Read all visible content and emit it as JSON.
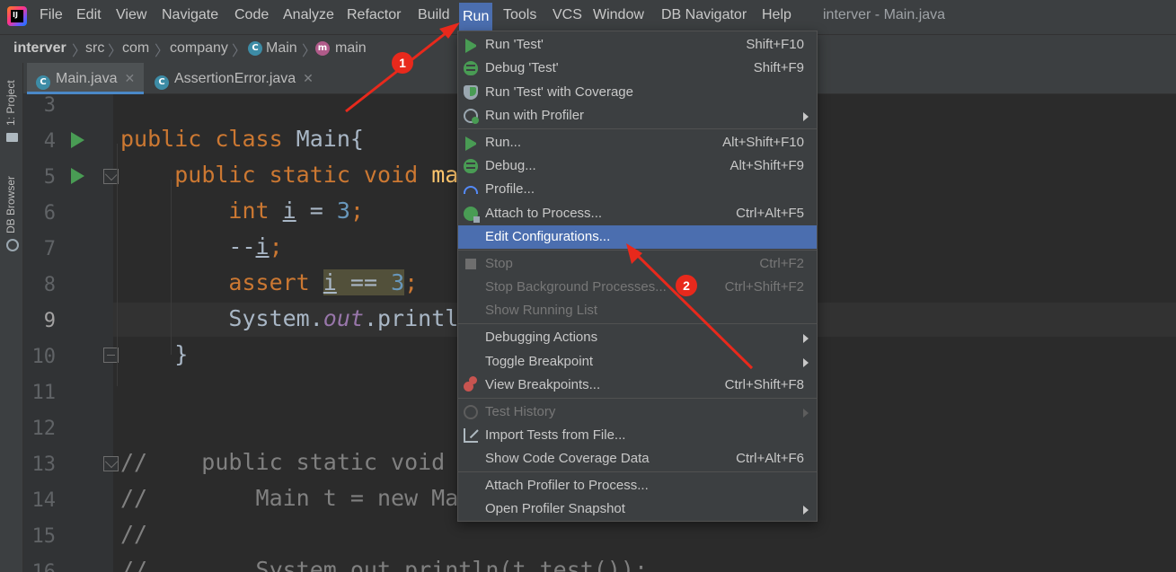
{
  "menubar": {
    "items": [
      "File",
      "Edit",
      "View",
      "Navigate",
      "Code",
      "Analyze",
      "Refactor",
      "Build",
      "Run",
      "Tools",
      "VCS",
      "Window",
      "DB Navigator",
      "Help"
    ],
    "window_title": "interver - Main.java"
  },
  "breadcrumbs": {
    "project": "interver",
    "dir1": "src",
    "dir2": "com",
    "dir3": "company",
    "class": "Main",
    "method": "main"
  },
  "tool_stripe": {
    "project": "1: Project",
    "db": "DB Browser"
  },
  "tabs": [
    {
      "label": "Main.java"
    },
    {
      "label": "AssertionError.java"
    }
  ],
  "editor": {
    "line_numbers": [
      "3",
      "4",
      "5",
      "6",
      "7",
      "8",
      "9",
      "10",
      "11",
      "12",
      "13",
      "14",
      "15",
      "16"
    ]
  },
  "run_menu": {
    "items": [
      {
        "label": "Run 'Test'",
        "shortcut": "Shift+F10",
        "icon": "run-icon"
      },
      {
        "label": "Debug 'Test'",
        "shortcut": "Shift+F9",
        "icon": "debug-icon"
      },
      {
        "label": "Run 'Test' with Coverage",
        "shortcut": "",
        "icon": "coverage-icon"
      },
      {
        "label": "Run with Profiler",
        "shortcut": "",
        "icon": "profiler-icon",
        "submenu": true
      },
      {
        "label": "Run...",
        "shortcut": "Alt+Shift+F10",
        "icon": "run-icon"
      },
      {
        "label": "Debug...",
        "shortcut": "Alt+Shift+F9",
        "icon": "debug-icon"
      },
      {
        "label": "Profile...",
        "shortcut": "",
        "icon": "gauge-icon"
      },
      {
        "label": "Attach to Process...",
        "shortcut": "Ctrl+Alt+F5",
        "icon": "attach-icon"
      },
      {
        "label": "Edit Configurations...",
        "shortcut": "",
        "icon": ""
      },
      {
        "label": "Stop",
        "shortcut": "Ctrl+F2",
        "icon": "stop-icon",
        "disabled": true
      },
      {
        "label": "Stop Background Processes...",
        "shortcut": "Ctrl+Shift+F2",
        "icon": "",
        "disabled": true
      },
      {
        "label": "Show Running List",
        "shortcut": "",
        "icon": "",
        "disabled": true
      },
      {
        "label": "Debugging Actions",
        "shortcut": "",
        "icon": "",
        "submenu": true
      },
      {
        "label": "Toggle Breakpoint",
        "shortcut": "",
        "icon": "",
        "submenu": true
      },
      {
        "label": "View Breakpoints...",
        "shortcut": "Ctrl+Shift+F8",
        "icon": "breakpoints-icon"
      },
      {
        "label": "Test History",
        "shortcut": "",
        "icon": "history-icon",
        "disabled": true,
        "submenu": true
      },
      {
        "label": "Import Tests from File...",
        "shortcut": "",
        "icon": "import-icon"
      },
      {
        "label": "Show Code Coverage Data",
        "shortcut": "Ctrl+Alt+F6",
        "icon": ""
      },
      {
        "label": "Attach Profiler to Process...",
        "shortcut": "",
        "icon": ""
      },
      {
        "label": "Open Profiler Snapshot",
        "shortcut": "",
        "icon": "",
        "submenu": true
      }
    ]
  },
  "annotations": {
    "badge1": "1",
    "badge2": "2",
    "color": "#e8291c"
  },
  "colors": {
    "selection": "#4b6eaf",
    "background": "#2b2b2b",
    "panel": "#3c3f41",
    "run_green": "#499c54"
  }
}
